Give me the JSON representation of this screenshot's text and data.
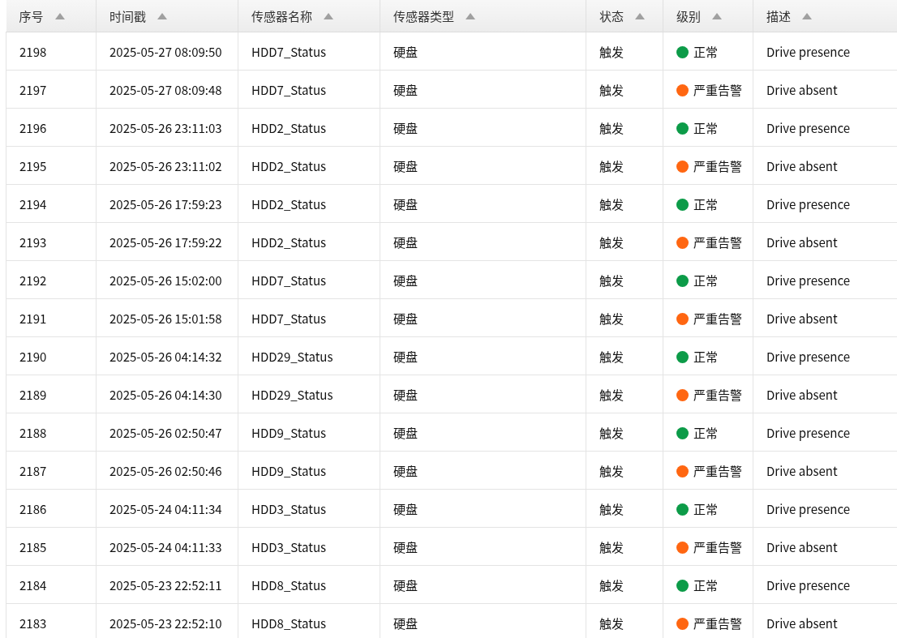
{
  "table": {
    "columns": [
      {
        "label": "序号",
        "sortable": true
      },
      {
        "label": "时间戳",
        "sortable": true
      },
      {
        "label": "传感器名称",
        "sortable": true
      },
      {
        "label": "传感器类型",
        "sortable": true
      },
      {
        "label": "状态",
        "sortable": true
      },
      {
        "label": "级别",
        "sortable": true
      },
      {
        "label": "描述",
        "sortable": true
      }
    ],
    "rows": [
      {
        "id": "2198",
        "time": "2025-05-27 08:09:50",
        "sensor": "HDD7_Status",
        "type": "硬盘",
        "state": "触发",
        "level": "正常",
        "color": "#0c9b48",
        "desc": "Drive presence"
      },
      {
        "id": "2197",
        "time": "2025-05-27 08:09:48",
        "sensor": "HDD7_Status",
        "type": "硬盘",
        "state": "触发",
        "level": "严重告警",
        "color": "#ff6611",
        "desc": "Drive absent"
      },
      {
        "id": "2196",
        "time": "2025-05-26 23:11:03",
        "sensor": "HDD2_Status",
        "type": "硬盘",
        "state": "触发",
        "level": "正常",
        "color": "#0c9b48",
        "desc": "Drive presence"
      },
      {
        "id": "2195",
        "time": "2025-05-26 23:11:02",
        "sensor": "HDD2_Status",
        "type": "硬盘",
        "state": "触发",
        "level": "严重告警",
        "color": "#ff6611",
        "desc": "Drive absent"
      },
      {
        "id": "2194",
        "time": "2025-05-26 17:59:23",
        "sensor": "HDD2_Status",
        "type": "硬盘",
        "state": "触发",
        "level": "正常",
        "color": "#0c9b48",
        "desc": "Drive presence"
      },
      {
        "id": "2193",
        "time": "2025-05-26 17:59:22",
        "sensor": "HDD2_Status",
        "type": "硬盘",
        "state": "触发",
        "level": "严重告警",
        "color": "#ff6611",
        "desc": "Drive absent"
      },
      {
        "id": "2192",
        "time": "2025-05-26 15:02:00",
        "sensor": "HDD7_Status",
        "type": "硬盘",
        "state": "触发",
        "level": "正常",
        "color": "#0c9b48",
        "desc": "Drive presence"
      },
      {
        "id": "2191",
        "time": "2025-05-26 15:01:58",
        "sensor": "HDD7_Status",
        "type": "硬盘",
        "state": "触发",
        "level": "严重告警",
        "color": "#ff6611",
        "desc": "Drive absent"
      },
      {
        "id": "2190",
        "time": "2025-05-26 04:14:32",
        "sensor": "HDD29_Status",
        "type": "硬盘",
        "state": "触发",
        "level": "正常",
        "color": "#0c9b48",
        "desc": "Drive presence"
      },
      {
        "id": "2189",
        "time": "2025-05-26 04:14:30",
        "sensor": "HDD29_Status",
        "type": "硬盘",
        "state": "触发",
        "level": "严重告警",
        "color": "#ff6611",
        "desc": "Drive absent"
      },
      {
        "id": "2188",
        "time": "2025-05-26 02:50:47",
        "sensor": "HDD9_Status",
        "type": "硬盘",
        "state": "触发",
        "level": "正常",
        "color": "#0c9b48",
        "desc": "Drive presence"
      },
      {
        "id": "2187",
        "time": "2025-05-26 02:50:46",
        "sensor": "HDD9_Status",
        "type": "硬盘",
        "state": "触发",
        "level": "严重告警",
        "color": "#ff6611",
        "desc": "Drive absent"
      },
      {
        "id": "2186",
        "time": "2025-05-24 04:11:34",
        "sensor": "HDD3_Status",
        "type": "硬盘",
        "state": "触发",
        "level": "正常",
        "color": "#0c9b48",
        "desc": "Drive presence"
      },
      {
        "id": "2185",
        "time": "2025-05-24 04:11:33",
        "sensor": "HDD3_Status",
        "type": "硬盘",
        "state": "触发",
        "level": "严重告警",
        "color": "#ff6611",
        "desc": "Drive absent"
      },
      {
        "id": "2184",
        "time": "2025-05-23 22:52:11",
        "sensor": "HDD8_Status",
        "type": "硬盘",
        "state": "触发",
        "level": "正常",
        "color": "#0c9b48",
        "desc": "Drive presence"
      },
      {
        "id": "2183",
        "time": "2025-05-23 22:52:10",
        "sensor": "HDD8_Status",
        "type": "硬盘",
        "state": "触发",
        "level": "严重告警",
        "color": "#ff6611",
        "desc": "Drive absent"
      }
    ]
  }
}
